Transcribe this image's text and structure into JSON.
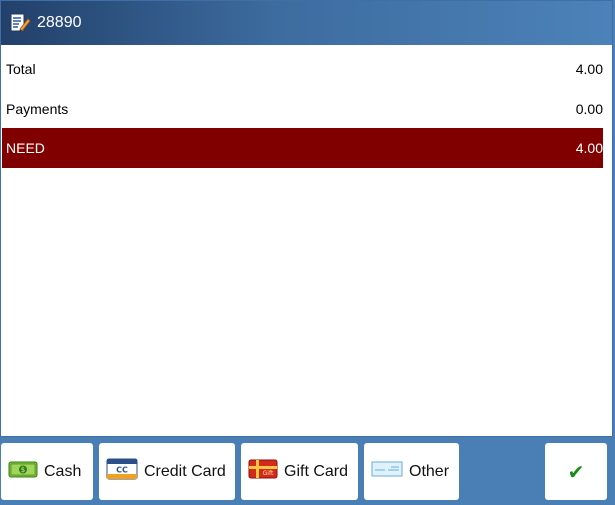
{
  "window": {
    "title": "28890"
  },
  "summary": {
    "total_label": "Total",
    "total_value": "4.00",
    "payments_label": "Payments",
    "payments_value": "0.00",
    "need_label": "NEED",
    "need_value": "4.00"
  },
  "buttons": {
    "cash": "Cash",
    "credit_card": "Credit Card",
    "gift_card": "Gift Card",
    "other": "Other",
    "confirm": "✔"
  },
  "icons": {
    "title": "edit-document-icon",
    "cash": "cash-icon",
    "credit_card": "credit-card-icon",
    "gift_card": "gift-card-icon",
    "other": "check-icon",
    "confirm": "checkmark-icon"
  },
  "colors": {
    "need_background": "#800000",
    "toolbar_background": "#4a7fb5",
    "confirm_check": "#1a8a1a"
  }
}
